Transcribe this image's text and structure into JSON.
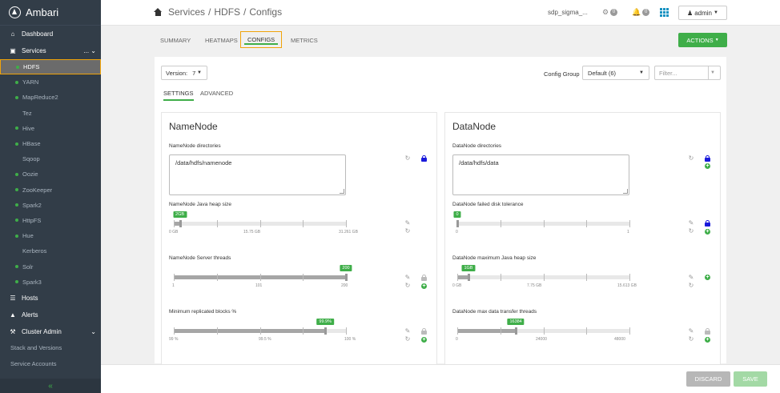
{
  "sidebar": {
    "logo": "Ambari",
    "dashboard": "Dashboard",
    "services": "Services",
    "services_more": "...",
    "service_items": [
      {
        "label": "HDFS",
        "status": "green",
        "active": true
      },
      {
        "label": "YARN",
        "status": "green"
      },
      {
        "label": "MapReduce2",
        "status": "green"
      },
      {
        "label": "Tez",
        "status": "none"
      },
      {
        "label": "Hive",
        "status": "green"
      },
      {
        "label": "HBase",
        "status": "green"
      },
      {
        "label": "Sqoop",
        "status": "none"
      },
      {
        "label": "Oozie",
        "status": "green"
      },
      {
        "label": "ZooKeeper",
        "status": "green"
      },
      {
        "label": "Spark2",
        "status": "green"
      },
      {
        "label": "HttpFS",
        "status": "green"
      },
      {
        "label": "Hue",
        "status": "green"
      },
      {
        "label": "Kerberos",
        "status": "none"
      },
      {
        "label": "Solr",
        "status": "green"
      },
      {
        "label": "Spark3",
        "status": "green"
      }
    ],
    "hosts": "Hosts",
    "alerts": "Alerts",
    "cluster_admin": "Cluster Admin",
    "stack_versions": "Stack and Versions",
    "service_accounts": "Service Accounts",
    "collapse": "«"
  },
  "topbar": {
    "crumb": [
      "Services",
      "HDFS",
      "Configs"
    ],
    "separator": "/",
    "cluster_name": "sdp_sigma_...",
    "ops_count": "0",
    "alerts_count": "0",
    "user": "admin"
  },
  "tabs": [
    "SUMMARY",
    "HEATMAPS",
    "CONFIGS",
    "METRICS"
  ],
  "actions_label": "ACTIONS",
  "toolbar": {
    "version_label": "Version:",
    "version_value": "7",
    "config_group_label": "Config Group",
    "config_group_value": "Default (6)",
    "filter_placeholder": "Filter..."
  },
  "settings_tabs": [
    "SETTINGS",
    "ADVANCED"
  ],
  "namenode": {
    "title": "NameNode",
    "dirs_label": "NameNode directories",
    "dirs_value": "/data/hdfs/namenode",
    "heap_label": "NameNode Java heap size",
    "heap_value": "2GB",
    "heap_fraction": 0.035,
    "heap_ticks": [
      "0 GB",
      "15.75 GB",
      "31.261 GB"
    ],
    "threads_label": "NameNode Server threads",
    "threads_value": "200",
    "threads_fraction": 1.0,
    "threads_ticks": [
      "1",
      "101",
      "200"
    ],
    "minrep_label": "Minimum replicated blocks %",
    "minrep_value": "99.9%",
    "minrep_fraction": 0.88,
    "minrep_ticks": [
      "99 %",
      "99.5 %",
      "100 %"
    ]
  },
  "datanode": {
    "title": "DataNode",
    "dirs_label": "DataNode directories",
    "dirs_value": "/data/hdfs/data",
    "tolerance_label": "DataNode failed disk tolerance",
    "tolerance_value": "0",
    "tolerance_fraction": 0,
    "tolerance_ticks": [
      "0",
      "1"
    ],
    "heap_label": "DataNode maximum Java heap size",
    "heap_value": "1GB",
    "heap_fraction": 0.065,
    "heap_ticks": [
      "0 GB",
      "7.75 GB",
      "15.613 GB"
    ],
    "xfer_label": "DataNode max data transfer threads",
    "xfer_value": "16384",
    "xfer_fraction": 0.34,
    "xfer_ticks": [
      "0",
      "24000",
      "48000"
    ]
  },
  "footer": {
    "discard": "DISCARD",
    "save": "SAVE"
  },
  "colors": {
    "accent_green": "#3fae49",
    "highlight": "#f0a30a",
    "sidebar_bg": "#323d48",
    "lock_blue": "#1a1adb"
  }
}
